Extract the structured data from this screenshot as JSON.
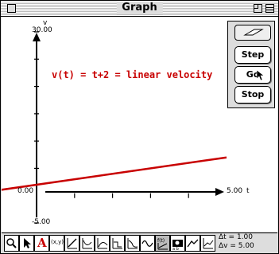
{
  "window": {
    "title": "Graph"
  },
  "graph": {
    "y_axis_letter": "v",
    "y_max_label": "30.00",
    "y_min_label": "-5.00",
    "x_min_label": "0.00",
    "x_max_label": "5.00",
    "x_axis_letter": "t",
    "equation": "v(t) = t+2 = linear velocity",
    "line_color": "#c80000"
  },
  "chart_data": {
    "type": "line",
    "title": "v(t) = t+2 = linear velocity",
    "xlabel": "t",
    "ylabel": "v",
    "xlim": [
      0,
      5
    ],
    "ylim": [
      -5,
      30
    ],
    "x": [
      -1.7,
      5
    ],
    "series": [
      {
        "values": [
          0.3,
          7.0
        ]
      }
    ]
  },
  "controls": {
    "step_label": "Step",
    "go_label": "Go",
    "stop_label": "Stop"
  },
  "toolbar": {
    "tools": [
      "magnifier-icon",
      "arrow-icon",
      "text-tool-icon",
      "xy-readout-icon",
      "line-icon",
      "derivative-icon",
      "slope-icon",
      "tangent-icon",
      "integral-icon",
      "curve-icon",
      "function-icon",
      "data-icon",
      "auto-scale-icon",
      "graph-type-icon"
    ],
    "xy_label": "(x,y)",
    "text_tool_label": "A",
    "delta_t": "Δt = 1.00",
    "delta_v": "Δv = 5.00"
  }
}
